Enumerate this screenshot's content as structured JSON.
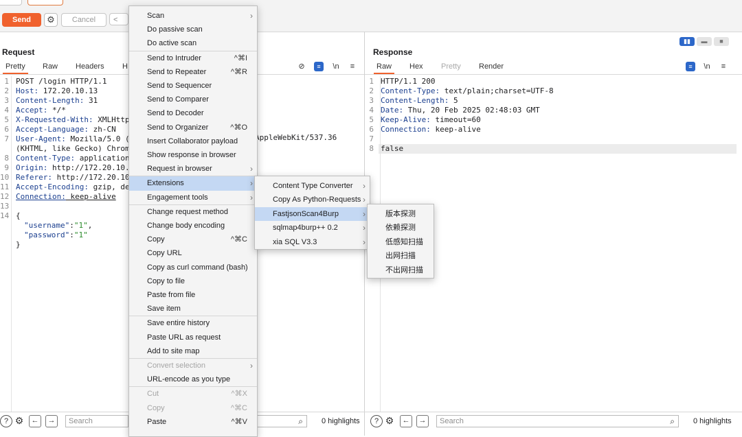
{
  "toolbar": {
    "send": "Send",
    "cancel": "Cancel",
    "back": "<"
  },
  "request": {
    "title": "Request",
    "tabs": [
      "Pretty",
      "Raw",
      "Headers",
      "Hex"
    ],
    "visible_tab_fragment": "H",
    "lines": [
      {
        "n": "1",
        "text": "POST /login HTTP/1.1"
      },
      {
        "n": "2",
        "key": "Host:",
        "val": " 172.20.10.13"
      },
      {
        "n": "3",
        "key": "Content-Length:",
        "val": " 31"
      },
      {
        "n": "4",
        "key": "Accept:",
        "val": " */*"
      },
      {
        "n": "5",
        "key": "X-Requested-With:",
        "val": " XMLHttpR"
      },
      {
        "n": "6",
        "key": "Accept-Language:",
        "val": " zh-CN"
      },
      {
        "n": "7",
        "key": "User-Agent:",
        "val": " Mozilla/5.0 (W"
      },
      {
        "n": "",
        "text": "(KHTML, like Gecko) Chrome"
      },
      {
        "n": "8",
        "key": "Content-Type:",
        "val": " application/"
      },
      {
        "n": "9",
        "key": "Origin:",
        "val": " http://172.20.10.1"
      },
      {
        "n": "10",
        "key": "Referer:",
        "val": " http://172.20.10"
      },
      {
        "n": "11",
        "key": "Accept-Encoding:",
        "val": " gzip, def"
      },
      {
        "n": "12",
        "key": "Connection:",
        "val": " keep-alive"
      },
      {
        "n": "13",
        "text": ""
      },
      {
        "n": "14",
        "text": "{"
      }
    ],
    "json_lines": [
      {
        "key": "\"username\"",
        "val": "\"1\"",
        "tail": ","
      },
      {
        "key": "\"password\"",
        "val": "\"1\"",
        "tail": ""
      }
    ],
    "closing_brace": "}",
    "user_agent_tail": "AppleWebKit/537.36",
    "search_placeholder": "Search",
    "highlights": "0 highlights"
  },
  "response": {
    "title": "Response",
    "tabs": [
      "Raw",
      "Hex",
      "Pretty",
      "Render"
    ],
    "lines": [
      {
        "n": "1",
        "text": "HTTP/1.1 200"
      },
      {
        "n": "2",
        "key": "Content-Type:",
        "val": " text/plain;charset=UTF-8"
      },
      {
        "n": "3",
        "key": "Content-Length:",
        "val": " 5"
      },
      {
        "n": "4",
        "key": "Date:",
        "val": " Thu, 20 Feb 2025 02:48:03 GMT"
      },
      {
        "n": "5",
        "key": "Keep-Alive:",
        "val": " timeout=60"
      },
      {
        "n": "6",
        "key": "Connection:",
        "val": " keep-alive"
      },
      {
        "n": "7",
        "text": ""
      },
      {
        "n": "8",
        "text": "false"
      }
    ],
    "search_placeholder": "Search",
    "highlights": "0 highlights"
  },
  "icons": {
    "newline": "\\n",
    "menu": "≡",
    "help": "?",
    "settings": "⚙",
    "prev": "←",
    "next": "→",
    "search": "⌕"
  },
  "context_menu": {
    "items": [
      {
        "label": "Scan",
        "submenu": true
      },
      {
        "label": "Do passive scan"
      },
      {
        "label": "Do active scan",
        "sep_after": true
      },
      {
        "label": "Send to Intruder",
        "shortcut": "^⌘I"
      },
      {
        "label": "Send to Repeater",
        "shortcut": "^⌘R"
      },
      {
        "label": "Send to Sequencer"
      },
      {
        "label": "Send to Comparer"
      },
      {
        "label": "Send to Decoder"
      },
      {
        "label": "Send to Organizer",
        "shortcut": "^⌘O"
      },
      {
        "label": "Insert Collaborator payload"
      },
      {
        "label": "Show response in browser"
      },
      {
        "label": "Request in browser",
        "submenu": true,
        "sep_after": true
      },
      {
        "label": "Extensions",
        "submenu": true,
        "highlighted": true
      },
      {
        "label": "Engagement tools",
        "submenu": true,
        "sep_after": true
      },
      {
        "label": "Change request method"
      },
      {
        "label": "Change body encoding"
      },
      {
        "label": "Copy",
        "shortcut": "^⌘C"
      },
      {
        "label": "Copy URL"
      },
      {
        "label": "Copy as curl command (bash)"
      },
      {
        "label": "Copy to file"
      },
      {
        "label": "Paste from file"
      },
      {
        "label": "Save item",
        "sep_after": true
      },
      {
        "label": "Save entire history"
      },
      {
        "label": "Paste URL as request"
      },
      {
        "label": "Add to site map",
        "sep_after": true
      },
      {
        "label": "Convert selection",
        "submenu": true,
        "disabled": true
      },
      {
        "label": "URL-encode as you type",
        "sep_after": true
      },
      {
        "label": "Cut",
        "shortcut": "^⌘X",
        "disabled": true
      },
      {
        "label": "Copy",
        "shortcut": "^⌘C",
        "disabled": true
      },
      {
        "label": "Paste",
        "shortcut": "^⌘V"
      }
    ]
  },
  "extensions_menu": {
    "items": [
      {
        "label": "Content Type Converter",
        "submenu": true
      },
      {
        "label": "Copy As Python-Requests",
        "submenu": true
      },
      {
        "label": "FastjsonScan4Burp",
        "submenu": true,
        "highlighted": true
      },
      {
        "label": "sqlmap4burp++ 0.2",
        "submenu": true
      },
      {
        "label": "xia SQL V3.3",
        "submenu": true
      }
    ]
  },
  "fastjson_menu": {
    "items": [
      {
        "label": "版本探测"
      },
      {
        "label": "依赖探测"
      },
      {
        "label": "低感知扫描"
      },
      {
        "label": "出网扫描"
      },
      {
        "label": "不出网扫描"
      }
    ]
  },
  "colors": {
    "accent": "#f0612d",
    "selection": "#c4d8f3",
    "header_key": "#1b3f8f",
    "json_string": "#2a8a2a"
  }
}
